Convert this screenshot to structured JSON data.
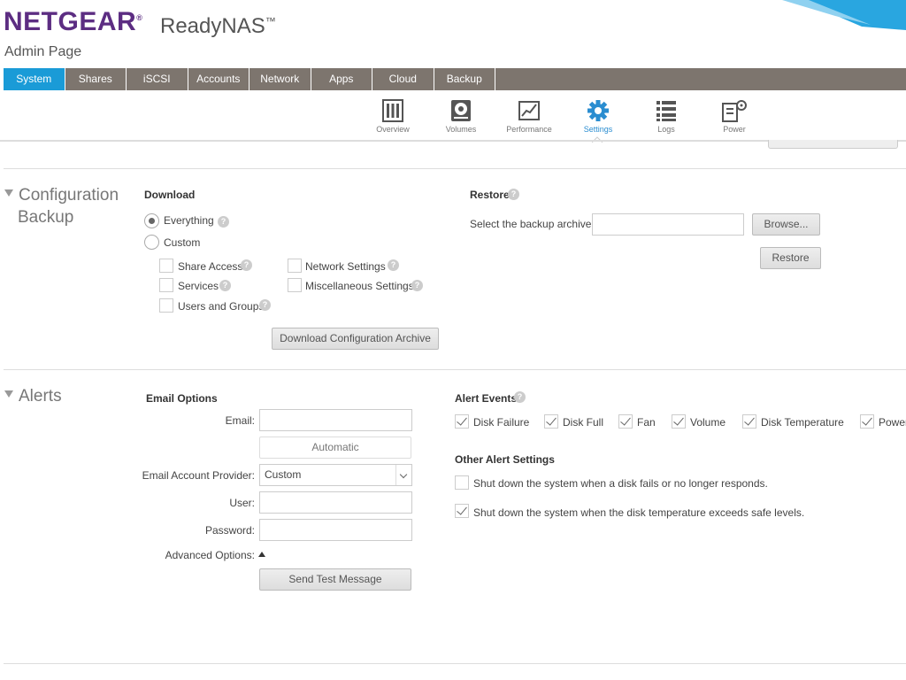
{
  "header": {
    "brand": "NETGEAR",
    "product": "ReadyNAS",
    "product_mark": "™",
    "brand_mark": "®",
    "subtitle": "Admin Page"
  },
  "nav": {
    "tabs": [
      "System",
      "Shares",
      "iSCSI",
      "Accounts",
      "Network",
      "Apps",
      "Cloud",
      "Backup"
    ],
    "active": "System"
  },
  "subnav": {
    "items": [
      {
        "label": "Overview",
        "icon": "overview-icon"
      },
      {
        "label": "Volumes",
        "icon": "volumes-icon"
      },
      {
        "label": "Performance",
        "icon": "performance-icon"
      },
      {
        "label": "Settings",
        "icon": "settings-gear-icon"
      },
      {
        "label": "Logs",
        "icon": "logs-icon"
      },
      {
        "label": "Power",
        "icon": "power-icon"
      }
    ],
    "active": "Settings"
  },
  "config_backup": {
    "title_line1": "Configuration",
    "title_line2": "Backup",
    "download": {
      "heading": "Download",
      "everything_label": "Everything",
      "custom_label": "Custom",
      "selected": "Everything",
      "options": {
        "share_access": "Share Access",
        "services": "Services",
        "users_groups": "Users and Groups",
        "network_settings": "Network Settings",
        "misc_settings": "Miscellaneous Settings"
      },
      "button": "Download Configuration Archive"
    },
    "restore": {
      "heading": "Restore",
      "archive_label": "Select the backup archive:",
      "archive_value": "",
      "browse_button": "Browse...",
      "restore_button": "Restore"
    }
  },
  "alerts": {
    "title": "Alerts",
    "email_options": {
      "heading": "Email Options",
      "email_label": "Email:",
      "email_value": "",
      "automatic_button": "Automatic",
      "provider_label": "Email Account Provider:",
      "provider_value": "Custom",
      "user_label": "User:",
      "user_value": "",
      "password_label": "Password:",
      "password_value": "",
      "advanced_label": "Advanced Options:",
      "test_button": "Send Test Message"
    },
    "alert_events": {
      "heading": "Alert Events",
      "items": [
        {
          "label": "Disk Failure",
          "checked": true
        },
        {
          "label": "Disk Full",
          "checked": true
        },
        {
          "label": "Fan",
          "checked": true
        },
        {
          "label": "Volume",
          "checked": true
        },
        {
          "label": "Disk Temperature",
          "checked": true
        },
        {
          "label": "Power",
          "checked": true
        }
      ]
    },
    "other": {
      "heading": "Other Alert Settings",
      "disk_fail_shutdown": "Shut down the system when a disk fails or no longer responds.",
      "disk_fail_checked": false,
      "temp_shutdown": "Shut down the system when the disk temperature exceeds safe levels.",
      "temp_checked": true
    }
  },
  "help_glyph": "?",
  "colors": {
    "brand_purple": "#5c2d82",
    "nav_bar": "#7d756e",
    "nav_active": "#1a9bd7",
    "accent_blue": "#2a8dd0"
  }
}
